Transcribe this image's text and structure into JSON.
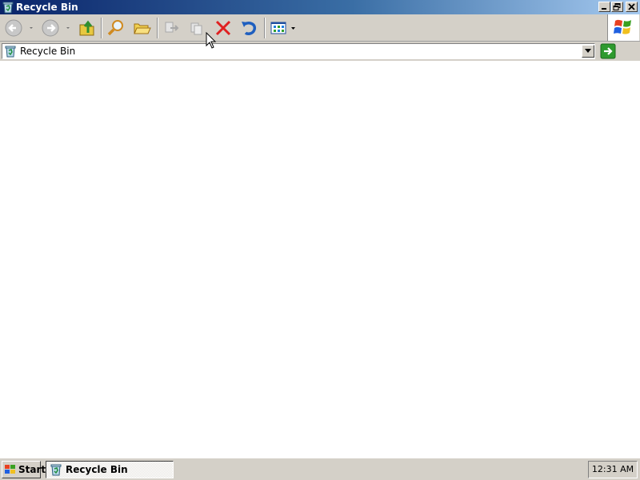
{
  "window": {
    "title": "Recycle Bin",
    "title_icon": "recycle-bin-icon"
  },
  "toolbar": {
    "buttons": [
      {
        "name": "back",
        "icon": "back-arrow-icon",
        "enabled": false
      },
      {
        "name": "forward",
        "icon": "forward-arrow-icon",
        "enabled": false
      },
      {
        "name": "up",
        "icon": "folder-up-icon",
        "enabled": true
      },
      {
        "name": "search",
        "icon": "search-icon",
        "enabled": true
      },
      {
        "name": "folders",
        "icon": "folders-icon",
        "enabled": true
      },
      {
        "name": "move-to",
        "icon": "move-to-icon",
        "enabled": false
      },
      {
        "name": "copy-to",
        "icon": "copy-to-icon",
        "enabled": false
      },
      {
        "name": "delete",
        "icon": "delete-x-icon",
        "enabled": true
      },
      {
        "name": "undo",
        "icon": "undo-icon",
        "enabled": true
      },
      {
        "name": "views",
        "icon": "views-icon",
        "enabled": true
      }
    ],
    "brand_icon": "windows-logo-icon"
  },
  "address": {
    "value": "Recycle Bin",
    "icon": "recycle-bin-icon",
    "go_icon": "go-arrow-icon"
  },
  "taskbar": {
    "start_label": "Start",
    "task_label": "Recycle Bin",
    "clock": "12:31 AM"
  },
  "colors": {
    "titlebar_start": "#0a246a",
    "titlebar_end": "#a6caf0",
    "face": "#d4d0c8",
    "delete_red": "#e02020",
    "undo_blue": "#1f5fbf",
    "go_green": "#2e9a2e"
  }
}
